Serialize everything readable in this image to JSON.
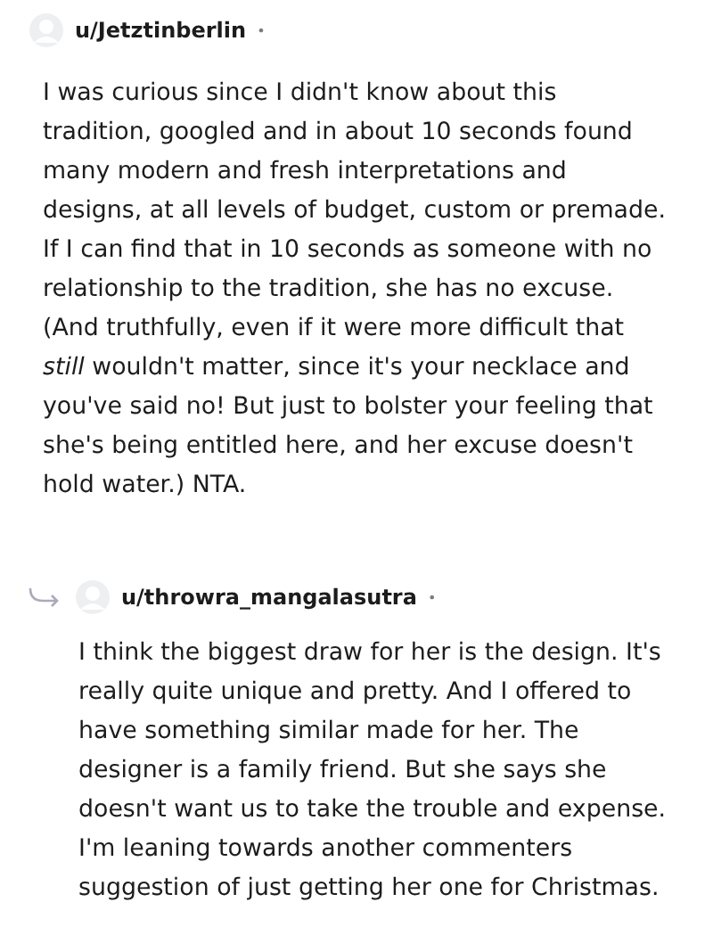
{
  "comments": [
    {
      "author": "u/Jetztinberlin",
      "separator": "•",
      "reply": false,
      "body": "I was curious since I didn't know about this tradition, googled and in about 10 seconds found many modern and fresh interpretations and designs, at all levels of budget, custom or premade. If I can find that in 10 seconds as someone with no relationship to the tradition, she has no excuse. (And truthfully, even if it were more difficult that *still* wouldn't matter, since it's your necklace and you've said no! But just to bolster your feeling that she's being entitled here, and her excuse doesn't hold water.) NTA."
    },
    {
      "author": "u/throwra_mangalasutra",
      "separator": "•",
      "reply": true,
      "body": "I think the biggest draw for her is the design. It's really quite unique and pretty. And I offered to have something similar made for her. The designer is a family friend. But she says she doesn't want us to take the trouble and expense. I'm leaning towards another commenters suggestion of just getting her one for Christmas."
    }
  ]
}
